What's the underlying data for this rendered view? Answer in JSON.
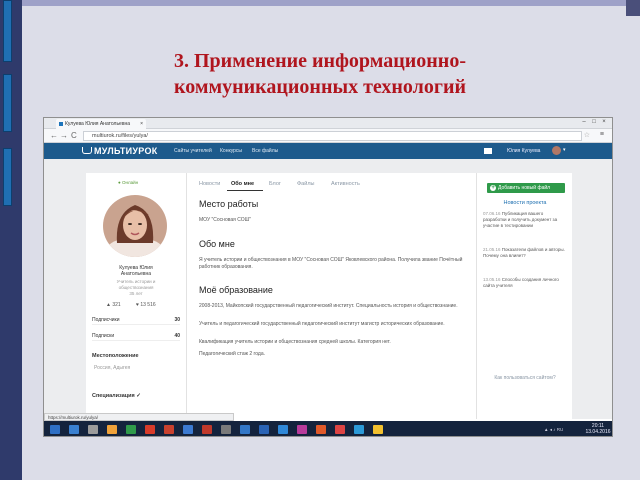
{
  "slide": {
    "title_line1": "3. Применение  информационно-",
    "title_line2": "коммуникационных технологий"
  },
  "browser": {
    "tab_title": "Кулуева Юлия Анатольевна",
    "tab_close": "×",
    "url": "multiurok.ru/files/yulya/",
    "back": "←",
    "forward": "→",
    "reload": "C",
    "star": "☆",
    "menu": "≡",
    "win_min": "–",
    "win_max": "□",
    "win_close": "×",
    "status_url": "https://multiurok.ru/yulya/"
  },
  "site": {
    "logo": "МУЛЬТИУРОК",
    "nav": [
      "Сайты учителей",
      "Конкурсы",
      "Все файлы"
    ],
    "user_name": "Юлия Кулуева",
    "user_caret": "▾"
  },
  "profile": {
    "online": "● Онлайн",
    "name_line1": "Кулуева Юлия",
    "name_line2": "Анатольевна",
    "role_line1": "Учитель истории и",
    "role_line2": "обществознания",
    "role_line3": "35 лет",
    "stats_views": "321",
    "stats_likes": "13 516",
    "rows": [
      {
        "label": "Подписчики",
        "value": "30"
      },
      {
        "label": "Подписки",
        "value": "40"
      }
    ],
    "location_label": "Местоположение",
    "location_value": "Россия, Адыгея",
    "specialty_label": "Специализация ✓"
  },
  "content": {
    "tabs": [
      "Новости",
      "Обо мне",
      "Блог",
      "Файлы",
      "Активность"
    ],
    "active_tab": "Обо мне",
    "workplace_h": "Место работы",
    "workplace_t": "МОУ \"Сосновая СОШ\"",
    "about_h": "Обо мне",
    "about_t": "Я учитель истории и обществознания в МОУ \"Сосновая СОШ\" Яковлевского района. Получила звание Почётный работник образования.",
    "edu_h": "Моё образование",
    "edu_t": [
      "2008-2013, Майкопский государственный педагогический институт. Специальность история и обществознание.",
      "Учитель и педагогический государственный педагогический институт магистр исторических образование.",
      "Квалификация учитель истории и обществознания средней школы. Категория нет.",
      "Педагогический стаж 2 года."
    ]
  },
  "sidebar": {
    "add_button": "Добавить новый файл",
    "news_heading": "Новости проекта",
    "news": [
      {
        "date": "07.06.16",
        "text": "Публикация вашего разработки и получить документ за участие в тестировании"
      },
      {
        "date": "21.05.16",
        "text": "Показатели файлов и авторы. Почему она влияет?"
      },
      {
        "date": "13.05.16",
        "text": "Способы создания личного сайта учителя"
      }
    ],
    "how_link": "Как пользоваться сайтом?"
  },
  "taskbar": {
    "tray": "▲ ◂ ♪ RU",
    "time": "20:11",
    "date": "13.04.2016",
    "icon_colors": [
      "#2e6fc4",
      "#3a80d0",
      "#9b9b9b",
      "#f0a23a",
      "#2f9a4a",
      "#d83b2a",
      "#c9412e",
      "#3c7ad1",
      "#c0392b",
      "#7a7a7a",
      "#3377c7",
      "#2a63b5",
      "#2f88d8",
      "#b83b9b",
      "#e0592a",
      "#d44",
      "#2c9ad8",
      "#f2c02e"
    ]
  }
}
